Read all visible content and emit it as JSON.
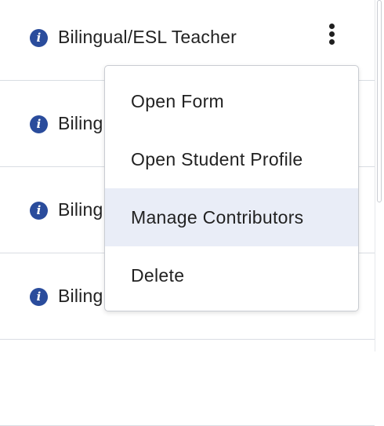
{
  "rows": [
    {
      "label": "Bilingual/ESL Teacher"
    },
    {
      "label": "Biling"
    },
    {
      "label": "Biling"
    },
    {
      "label": "Biling"
    }
  ],
  "info_icon_glyph": "i",
  "info_icon_color": "#2a4c9c",
  "menu": {
    "items": [
      {
        "label": "Open Form"
      },
      {
        "label": "Open Student Profile"
      },
      {
        "label": "Manage Contributors",
        "highlighted": true
      },
      {
        "label": "Delete"
      }
    ],
    "highlight_color": "#e9edf7"
  }
}
